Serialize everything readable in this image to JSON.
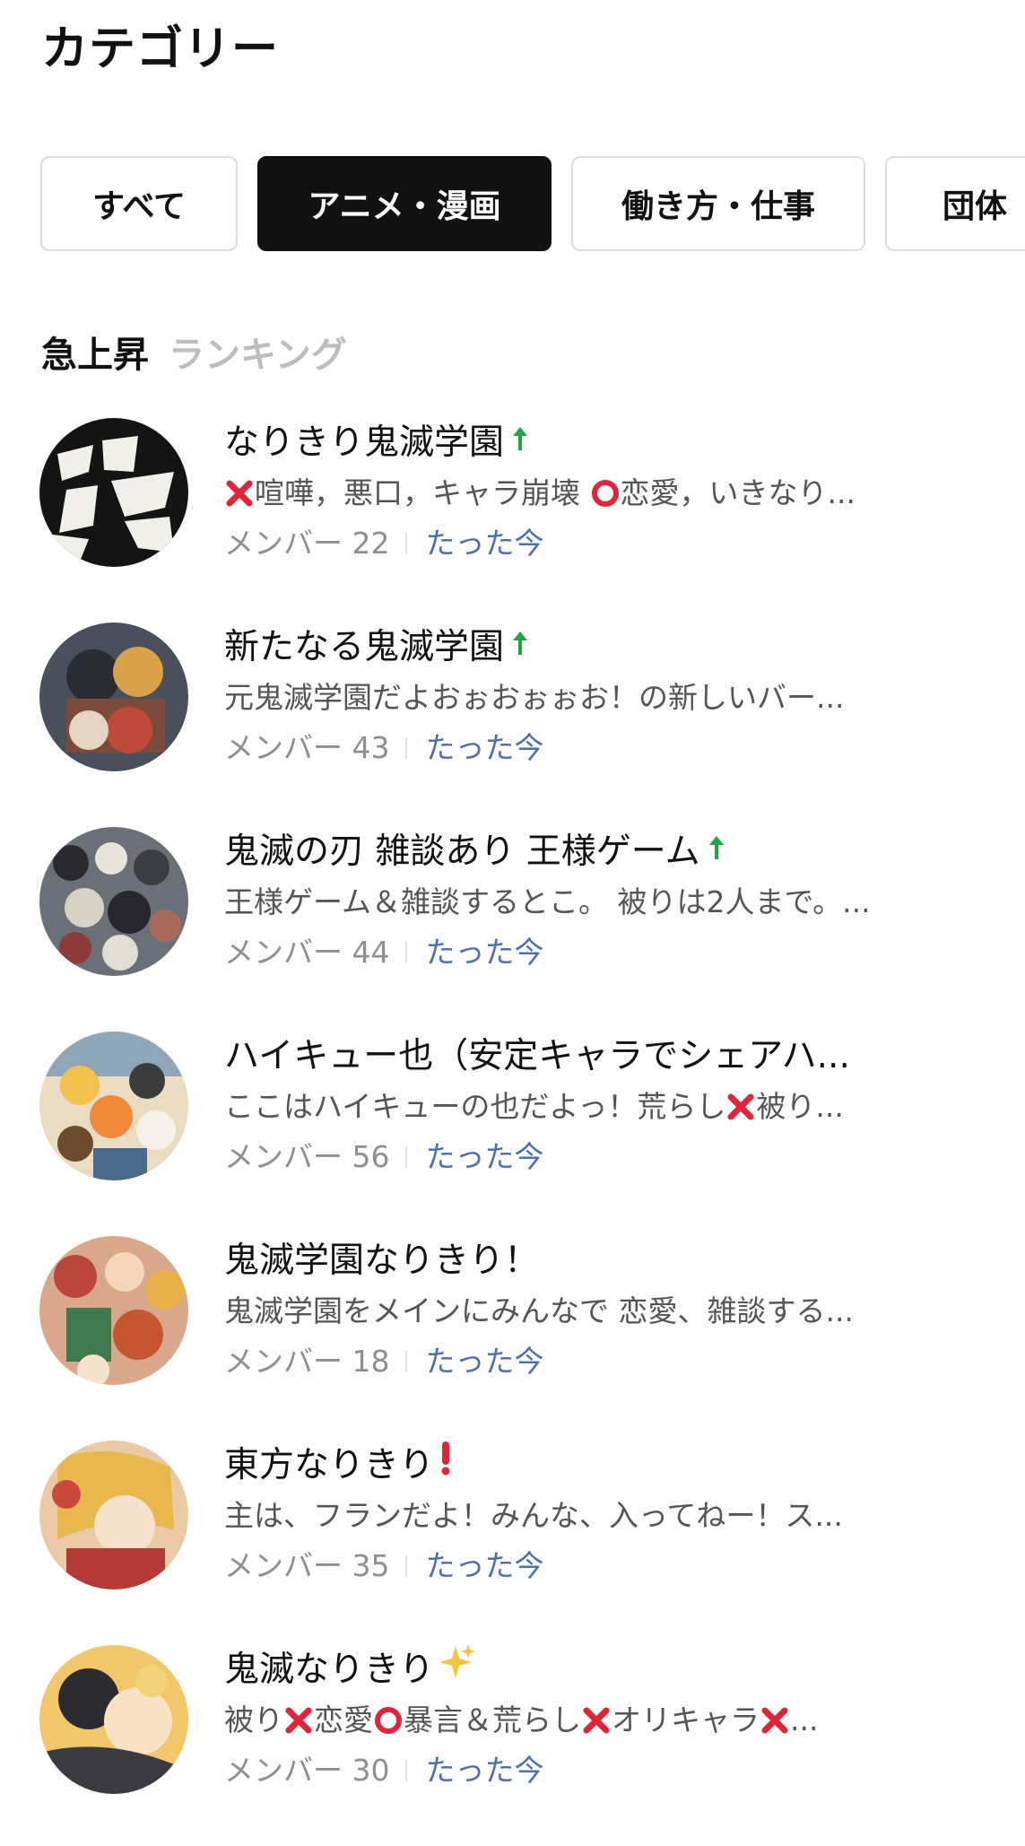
{
  "page": {
    "title": "カテゴリー"
  },
  "tabs": [
    {
      "label": "すべて",
      "active": false
    },
    {
      "label": "アニメ・漫画",
      "active": true
    },
    {
      "label": "働き方・仕事",
      "active": false
    },
    {
      "label": "団体",
      "active": false
    }
  ],
  "ranking": {
    "title": "急上昇",
    "subtitle": "ランキング"
  },
  "rooms": [
    {
      "title": "なりきり鬼滅学園",
      "trend_icon": "up-arrow-icon",
      "description_parts": [
        "",
        "喧嘩，悪口，キャラ崩壊 ",
        "恋愛，いきなり..."
      ],
      "member_label": "メンバー 22",
      "time": "たった今",
      "avatar": "kanji-avatar"
    },
    {
      "title": "新たなる鬼滅学園",
      "trend_icon": "up-arrow-icon",
      "description": "元鬼滅学園だよおぉおぉぉお！の新しいバー...",
      "member_label": "メンバー 43",
      "time": "たった今",
      "avatar": "anime-group-avatar"
    },
    {
      "title": "鬼滅の刃 雑談あり 王様ゲーム",
      "trend_icon": "up-arrow-icon",
      "description": "王様ゲーム＆雑談するとこ。 被りは2人まで。...",
      "member_label": "メンバー 44",
      "time": "たった今",
      "avatar": "anime-collage-avatar"
    },
    {
      "title": "ハイキュー也（安定キャラでシェアハ...",
      "trend_icon": "",
      "description_parts": [
        "ここはハイキューの也だよっ！荒らし",
        "被り..."
      ],
      "member_label": "メンバー 56",
      "time": "たった今",
      "avatar": "haikyu-avatar"
    },
    {
      "title": "鬼滅学園なりきり！",
      "trend_icon": "",
      "description": "鬼滅学園をメインにみんなで 恋愛、雑談する...",
      "member_label": "メンバー 18",
      "time": "たった今",
      "avatar": "warm-group-avatar"
    },
    {
      "title": "東方なりきり",
      "trend_icon": "exclamation-icon",
      "description": "主は、フランだよ！みんな、入ってねー！ス...",
      "member_label": "メンバー 35",
      "time": "たった今",
      "avatar": "touhou-avatar"
    },
    {
      "title": "鬼滅なりきり",
      "trend_icon": "sparkles-icon",
      "description_parts": [
        "被り",
        "恋愛",
        "暴言＆荒らし",
        "オリキャラ",
        "..."
      ],
      "member_label": "メンバー 30",
      "time": "たった今",
      "avatar": "yellow-anime-avatar"
    }
  ],
  "colors": {
    "accent_tab_bg": "#111111",
    "time_link": "#4f6fae",
    "trend_up": "#22a447",
    "x_mark": "#e0243a",
    "o_mark": "#e0243a"
  }
}
